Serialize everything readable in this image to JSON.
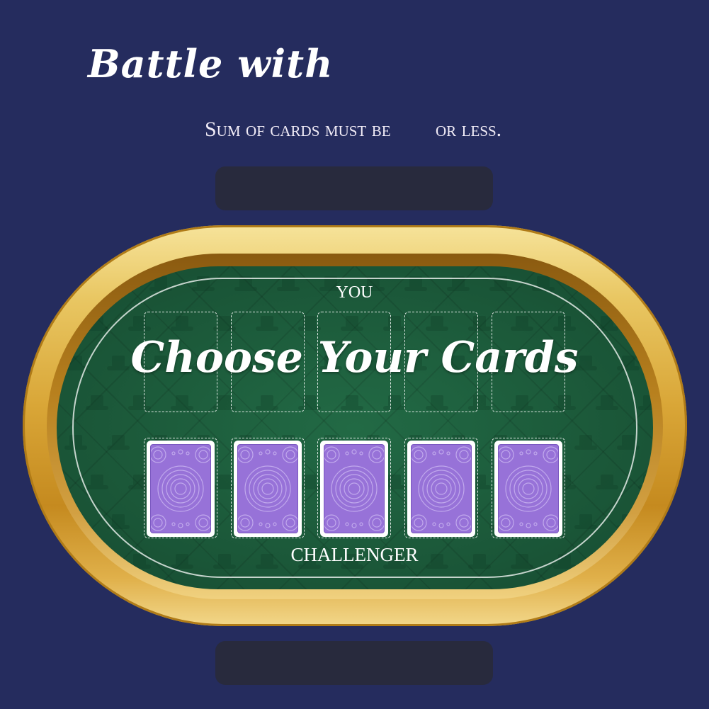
{
  "header": {
    "title": "Battle with",
    "rule_prefix": "Sum of cards must be",
    "rule_suffix": "or less."
  },
  "table": {
    "opponent_label": "YOU",
    "player_label": "CHALLENGER",
    "prompt": "Choose Your Cards",
    "top_slot_count": 5,
    "player_cards": [
      {
        "face": "down"
      },
      {
        "face": "down"
      },
      {
        "face": "down"
      },
      {
        "face": "down"
      },
      {
        "face": "down"
      }
    ]
  },
  "colors": {
    "background": "#252c5e",
    "felt": "#1c5b3b",
    "gold": "#d9a637",
    "card_back": "#9772d8",
    "bar": "#282a3d"
  }
}
